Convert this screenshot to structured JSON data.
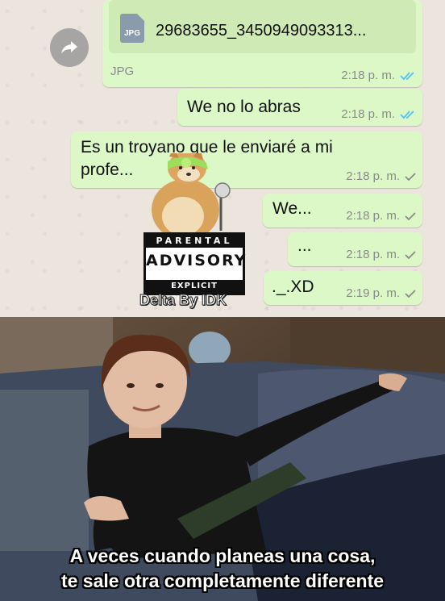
{
  "chat": {
    "file_message": {
      "icon_label": "JPG",
      "file_name": "29683655_3450949093313...",
      "file_type": "JPG",
      "time": "2:18 p. m.",
      "status": "read"
    },
    "messages": [
      {
        "text": "We no lo abras",
        "time": "2:18 p. m.",
        "status": "read"
      },
      {
        "text_line1": "Es un troyano que le enviaré a mi",
        "text_line2": "profe...",
        "time": "2:18 p. m.",
        "status": "sent"
      },
      {
        "text": "We...",
        "time": "2:18 p. m.",
        "status": "sent"
      },
      {
        "text": "...",
        "time": "2:18 p. m.",
        "status": "sent"
      },
      {
        "text": "._.XD",
        "time": "2:19 p. m.",
        "status": "sent"
      }
    ],
    "sticker": {
      "advisory_top": "PARENTAL",
      "advisory_main": "ADVISORY",
      "advisory_bottom": "EXPLICIT CONTENT",
      "watermark": "Delta By IDK"
    },
    "colors": {
      "bubble": "#dcf8c6",
      "read_tick": "#4fc3f7",
      "sent_tick": "#8a8a8a"
    }
  },
  "meme": {
    "caption_line1": "A veces cuando planeas una cosa,",
    "caption_line2": "te sale otra completamente diferente"
  }
}
